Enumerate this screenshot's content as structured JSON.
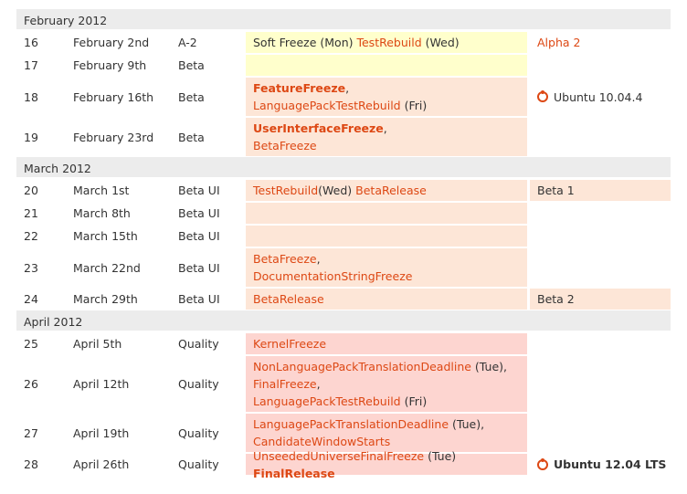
{
  "sections": [
    {
      "month": "February 2012",
      "rows": [
        {
          "week": "16",
          "date": "February 2nd",
          "phase": "A-2",
          "h": 25,
          "bg": "yellow",
          "notes": [
            [
              {
                "t": "Soft Freeze (Mon) "
              },
              {
                "t": "TestRebuild",
                "link": true
              },
              {
                "t": " (Wed)"
              }
            ]
          ],
          "release": {
            "text": "Alpha 2",
            "color": "red"
          }
        },
        {
          "week": "17",
          "date": "February 9th",
          "phase": "Beta",
          "h": 25,
          "bg": "yellow",
          "notes": []
        },
        {
          "week": "18",
          "date": "February 16th",
          "phase": "Beta",
          "h": 44,
          "bg": "peach",
          "notes": [
            [
              {
                "t": "FeatureFreeze",
                "link": true,
                "bold": true
              },
              {
                "t": ","
              }
            ],
            [
              {
                "t": "LanguagePackTestRebuild",
                "link": true
              },
              {
                "t": " (Fri)"
              }
            ]
          ],
          "release": {
            "text": "Ubuntu 10.04.4",
            "icon": "ubuntu-logo-icon"
          }
        },
        {
          "week": "19",
          "date": "February 23rd",
          "phase": "Beta",
          "h": 44,
          "bg": "peach",
          "notes": [
            [
              {
                "t": "UserInterfaceFreeze",
                "link": true,
                "bold": true
              },
              {
                "t": ","
              }
            ],
            [
              {
                "t": "BetaFreeze",
                "link": true
              }
            ]
          ]
        }
      ]
    },
    {
      "month": "March 2012",
      "rows": [
        {
          "week": "20",
          "date": "March 1st",
          "phase": "Beta UI",
          "h": 25,
          "bg": "peach",
          "relbg": "peach",
          "notes": [
            [
              {
                "t": "TestRebuild",
                "link": true
              },
              {
                "t": "(Wed) "
              },
              {
                "t": "BetaRelease",
                "link": true
              }
            ]
          ],
          "release": {
            "text": "Beta 1"
          }
        },
        {
          "week": "21",
          "date": "March 8th",
          "phase": "Beta UI",
          "h": 25,
          "bg": "peach",
          "notes": []
        },
        {
          "week": "22",
          "date": "March 15th",
          "phase": "Beta UI",
          "h": 25,
          "bg": "peach",
          "notes": []
        },
        {
          "week": "23",
          "date": "March 22nd",
          "phase": "Beta UI",
          "h": 44,
          "bg": "peach",
          "notes": [
            [
              {
                "t": "BetaFreeze",
                "link": true
              },
              {
                "t": ","
              }
            ],
            [
              {
                "t": "DocumentationStringFreeze",
                "link": true
              }
            ]
          ]
        },
        {
          "week": "24",
          "date": "March 29th",
          "phase": "Beta UI",
          "h": 25,
          "bg": "peach",
          "relbg": "peach",
          "notes": [
            [
              {
                "t": "BetaRelease",
                "link": true
              }
            ]
          ],
          "release": {
            "text": "Beta 2"
          }
        }
      ]
    },
    {
      "month": "April 2012",
      "rows": [
        {
          "week": "25",
          "date": "April 5th",
          "phase": "Quality",
          "h": 25,
          "bg": "pink",
          "notes": [
            [
              {
                "t": "KernelFreeze",
                "link": true
              }
            ]
          ]
        },
        {
          "week": "26",
          "date": "April 12th",
          "phase": "Quality",
          "h": 63,
          "bg": "pink",
          "notes": [
            [
              {
                "t": "NonLanguagePackTranslationDeadline",
                "link": true
              },
              {
                "t": " (Tue),"
              }
            ],
            [
              {
                "t": "FinalFreeze",
                "link": true
              },
              {
                "t": ","
              }
            ],
            [
              {
                "t": "LanguagePackTestRebuild",
                "link": true
              },
              {
                "t": " (Fri)"
              }
            ]
          ]
        },
        {
          "week": "27",
          "date": "April 19th",
          "phase": "Quality",
          "h": 44,
          "bg": "pink",
          "notes": [
            [
              {
                "t": "LanguagePackTranslationDeadline",
                "link": true
              },
              {
                "t": " (Tue),"
              }
            ],
            [
              {
                "t": "CandidateWindowStarts",
                "link": true
              }
            ]
          ]
        },
        {
          "week": "28",
          "date": "April 26th",
          "phase": "Quality",
          "h": 25,
          "bg": "pink",
          "notes": [
            [
              {
                "t": "UnseededUniverseFinalFreeze",
                "link": true
              },
              {
                "t": " (Tue) "
              },
              {
                "t": "FinalRelease",
                "link": true,
                "bold": true
              }
            ]
          ],
          "release": {
            "text": "Ubuntu 12.04 LTS",
            "icon": "ubuntu-logo-icon",
            "bold": true
          }
        }
      ]
    }
  ],
  "colors": {
    "link": "#dd4814",
    "yellow": "#ffffcc",
    "peach": "#fde6d7",
    "pink": "#fdd5d0",
    "month_bg": "#ececec"
  }
}
